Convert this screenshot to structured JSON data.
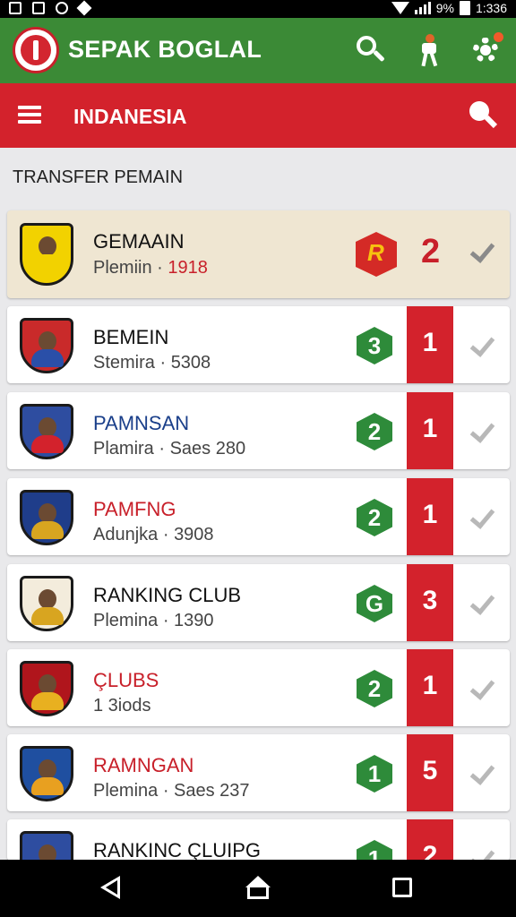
{
  "status_bar": {
    "battery": "9%",
    "time": "1:336"
  },
  "app_bar": {
    "title": "SEPAK BOGLAL",
    "icons": [
      "logo-icon",
      "search-icon",
      "player-icon",
      "gear-icon"
    ],
    "color": "#3b8a36"
  },
  "sub_bar": {
    "title": "INDANESIA",
    "color": "#d3222c"
  },
  "section": {
    "title": "TRANSFER PEMAIN"
  },
  "items": [
    {
      "name": "GEMAAIN",
      "meta_prefix": "Plemiin · ",
      "meta_value": "1918",
      "name_color": "#111111",
      "meta_value_color": "#c8202a",
      "badge": "",
      "rank": "2",
      "crest_color": "#f2d200",
      "crest_body": "#f2d200",
      "highlight": true
    },
    {
      "name": "BEMEIN",
      "meta_prefix": "Stemira · ",
      "meta_value": "5308",
      "name_color": "#111111",
      "meta_value_color": "#444444",
      "badge": "3",
      "rank": "1",
      "crest_color": "#c92a2a",
      "crest_body": "#2a4fa8",
      "highlight": false
    },
    {
      "name": "PAMNSAN",
      "meta_prefix": "Plamira · Saes ",
      "meta_value": "280",
      "name_color": "#1a3f8a",
      "meta_value_color": "#444444",
      "badge": "2",
      "rank": "1",
      "crest_color": "#2e4da0",
      "crest_body": "#d3222c",
      "highlight": false
    },
    {
      "name": "PAMFNG",
      "meta_prefix": "Adunjka · ",
      "meta_value": "3908",
      "name_color": "#c8202a",
      "meta_value_color": "#444444",
      "badge": "2",
      "rank": "1",
      "crest_color": "#1f3d8a",
      "crest_body": "#d8a520",
      "highlight": false
    },
    {
      "name": "RANKING CLUB",
      "meta_prefix": "Plemina · ",
      "meta_value": "1390",
      "name_color": "#111111",
      "meta_value_color": "#444444",
      "badge": "G",
      "rank": "3",
      "crest_color": "#f3ecdc",
      "crest_body": "#d8a520",
      "highlight": false
    },
    {
      "name": "ÇLUBS",
      "meta_prefix": "1 3iods",
      "meta_value": "",
      "name_color": "#c8202a",
      "meta_value_color": "#444444",
      "badge": "2",
      "rank": "1",
      "crest_color": "#b0151c",
      "crest_body": "#e8b020",
      "highlight": false
    },
    {
      "name": "RAMNGAN",
      "meta_prefix": "Plemina · Saes ",
      "meta_value": "237",
      "name_color": "#c8202a",
      "meta_value_color": "#444444",
      "badge": "1",
      "rank": "5",
      "crest_color": "#1f4fa0",
      "crest_body": "#e8a020",
      "highlight": false
    },
    {
      "name": "RANKINC ÇLUIPG",
      "meta_prefix": "",
      "meta_value": "",
      "name_color": "#111111",
      "meta_value_color": "#444444",
      "badge": "1",
      "rank": "2",
      "crest_color": "#2e4da0",
      "crest_body": "#d8a520",
      "highlight": false
    }
  ],
  "nav_bar": {
    "icons": [
      "back-icon",
      "home-icon",
      "recent-apps-icon"
    ]
  }
}
